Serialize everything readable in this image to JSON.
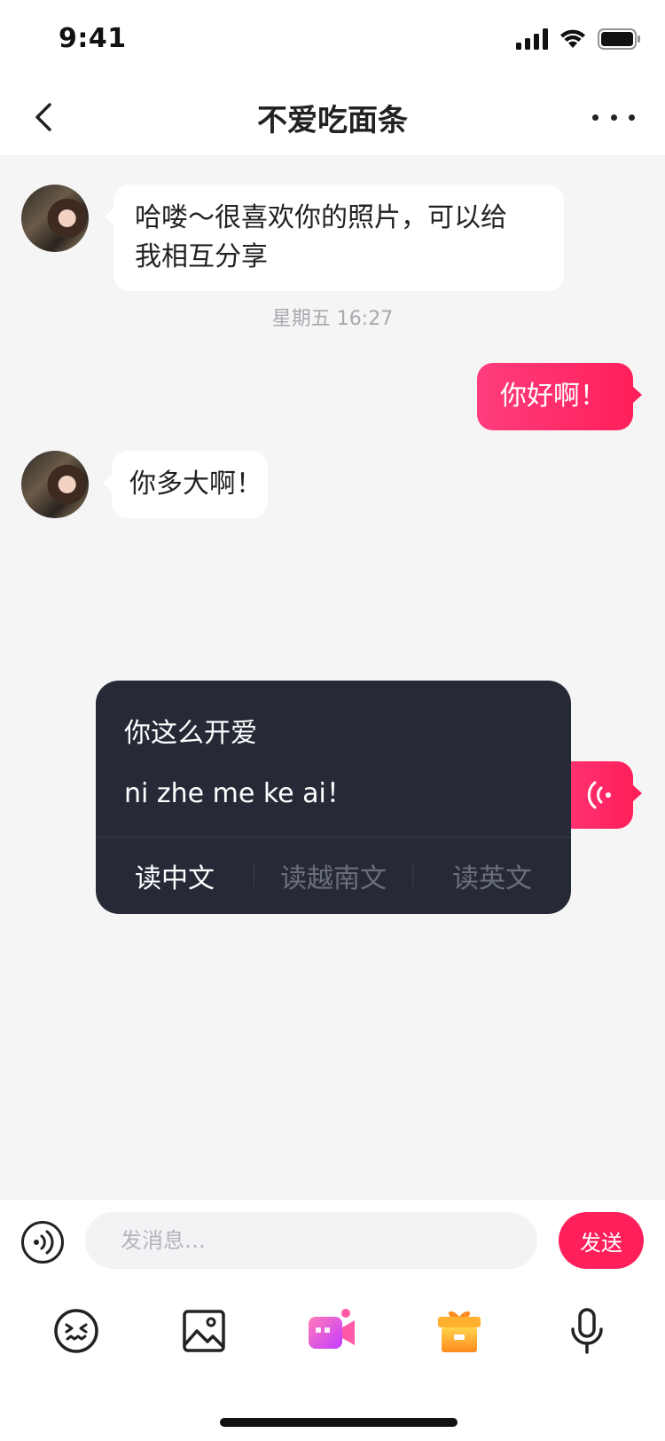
{
  "status_bar": {
    "time": "9:41"
  },
  "header": {
    "title": "不爱吃面条"
  },
  "messages": [
    {
      "side": "left",
      "text_line1": "哈喽～很喜欢你的照片，可以给",
      "text_line2": "我相互分享"
    },
    {
      "side": "center",
      "timestamp": "星期五 16:27"
    },
    {
      "side": "right",
      "text": "你好啊！"
    },
    {
      "side": "left",
      "text": "你多大啊！"
    }
  ],
  "translate_popup": {
    "chinese": "你这么开爱",
    "pinyin": "ni zhe me ke ai！",
    "actions": [
      "读中文",
      "读越南文",
      "读英文"
    ],
    "active_action": "读中文"
  },
  "input": {
    "placeholder": "发消息…",
    "send_label": "发送"
  },
  "toolbar": [
    "emoji-icon",
    "image-icon",
    "video-call-icon",
    "gift-icon",
    "microphone-icon"
  ],
  "colors": {
    "accent": "#ff1f5a",
    "popup_bg": "#262a36",
    "chat_bg": "#f5f5f5"
  }
}
